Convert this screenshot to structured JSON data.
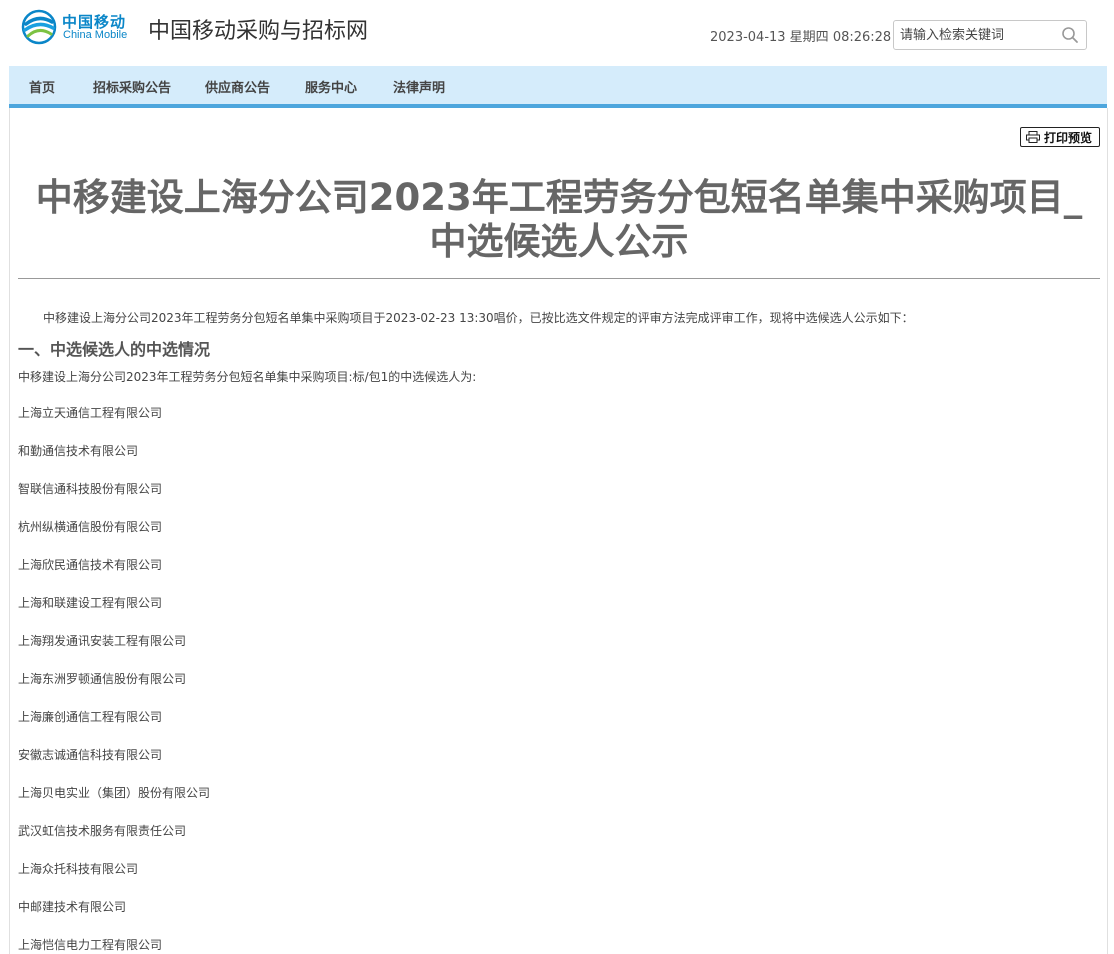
{
  "header": {
    "logo_cn": "中国移动",
    "logo_en": "China Mobile",
    "site_title": "中国移动采购与招标网",
    "datetime": "2023-04-13 星期四 08:26:28",
    "search_placeholder": "请输入检索关键词",
    "brand_color": "#0a86c8"
  },
  "nav": {
    "items": [
      {
        "label": "首页"
      },
      {
        "label": "招标采购公告"
      },
      {
        "label": "供应商公告"
      },
      {
        "label": "服务中心"
      },
      {
        "label": "法律声明"
      }
    ],
    "background": "#d5ecfb",
    "accent": "#4da6dd"
  },
  "document": {
    "print_label": "打印预览",
    "title_line1": "中移建设上海分公司2023年工程劳务分包短名单集中采购项目_",
    "title_line2": "中选候选人公示",
    "intro": "中移建设上海分公司2023年工程劳务分包短名单集中采购项目于2023-02-23 13:30唱价，已按比选文件规定的评审方法完成评审工作，现将中选候选人公示如下：",
    "section_heading": "一、中选候选人的中选情况",
    "package_line": "中移建设上海分公司2023年工程劳务分包短名单集中采购项目:标/包1的中选候选人为:",
    "companies": [
      "上海立天通信工程有限公司",
      "和勤通信技术有限公司",
      "智联信通科技股份有限公司",
      "杭州纵横通信股份有限公司",
      "上海欣民通信技术有限公司",
      "上海和联建设工程有限公司",
      "上海翔发通讯安装工程有限公司",
      "上海东洲罗顿通信股份有限公司",
      "上海廉创通信工程有限公司",
      "安徽志诚通信科技有限公司",
      "上海贝电实业（集团）股份有限公司",
      "武汉虹信技术服务有限责任公司",
      "上海众托科技有限公司",
      "中邮建技术有限公司",
      "上海恺信电力工程有限公司"
    ]
  }
}
